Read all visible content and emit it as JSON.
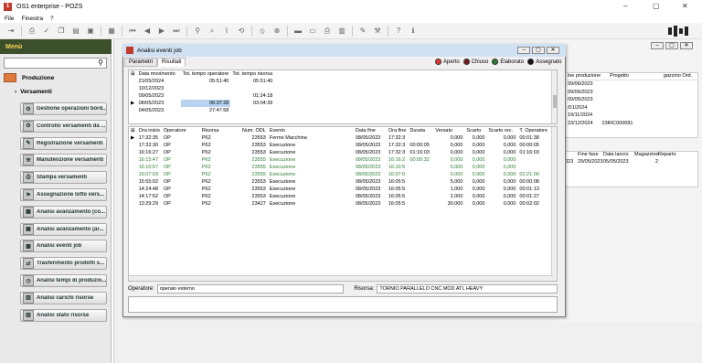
{
  "app": {
    "title": "OS1 enterprise - POZS"
  },
  "menubar": {
    "file": "File",
    "window": "Finestra",
    "help": "?"
  },
  "left": {
    "header": "Menù",
    "section": "Produzione",
    "subsection": "Versamenti",
    "items": [
      "Gestione operazioni bord...",
      "Controllo versamenti da ...",
      "Registrazione versamenti",
      "Manutenzione versamenti",
      "Stampa versamenti",
      "Assegnazione lotto vers...",
      "Analisi avanzamento (co...",
      "Analisi avanzamento (ar...",
      "Analisi eventi job",
      "Trasferimento prodotti s...",
      "Analisi tempi di produzio...",
      "Analisi carichi risorse",
      "Analisi stato risorse"
    ]
  },
  "background": {
    "headers": [
      "ine produzione",
      "Progetto",
      "gazzino Ord."
    ],
    "dates": [
      "09/06/2023",
      "09/06/2023",
      "09/05/2023",
      "/01/2024",
      "19/11/2024",
      "23/12/2024"
    ],
    "project": "23RIC000081",
    "headers2": [
      "",
      "Fine fase",
      "Data lancio",
      "Magazzino",
      "Reparto"
    ],
    "row2": [
      "023",
      "29/05/2023",
      "05/05/2023",
      "2",
      ""
    ]
  },
  "dialog": {
    "title": "Analisi eventi job",
    "tabs": [
      "Parametri",
      "Risultati"
    ],
    "legend": [
      {
        "label": "Aperto",
        "color": "#e53935"
      },
      {
        "label": "Chiuso",
        "color": "#7b1a1a"
      },
      {
        "label": "Elaborato",
        "color": "#2e7d32"
      },
      {
        "label": "Assegnato",
        "color": "#111111"
      }
    ],
    "upper": {
      "headers": [
        "Data movimento",
        "Tot. tempo operatore",
        "Tot. tempo risorsa"
      ],
      "rows": [
        [
          "21/05/2024",
          "05:51:40",
          "05:51:40"
        ],
        [
          "10/12/2023",
          "",
          ""
        ],
        [
          "09/05/2023",
          "",
          "01:24:18"
        ],
        [
          "08/05/2023",
          "06:37:28",
          "03:04:39"
        ],
        [
          "04/05/2023",
          "27:47:58",
          ""
        ]
      ]
    },
    "lower": {
      "headers": [
        "Ora inizio",
        "Operatore",
        "Risorsa",
        "Num. ODL",
        "Evento",
        "Data fine",
        "Ora fine",
        "Durata",
        "Versato",
        "Scarto",
        "Scarto rec.",
        "T. Operatore"
      ],
      "rows": [
        [
          "17:32:35",
          "OP",
          "P62",
          "23553",
          "Fermo Macchina",
          "08/05/2023",
          "17:32:3",
          "",
          "0,000",
          "0,000",
          "0,000",
          "00:01:38"
        ],
        [
          "17:32:30",
          "OP",
          "P62",
          "23553",
          "Esecuzione",
          "08/05/2023",
          "17:32:3",
          "00:00:05",
          "0,000",
          "0,000",
          "0,000",
          "00:00:05"
        ],
        [
          "16:16:27",
          "OP",
          "P62",
          "23553",
          "Esecuzione",
          "08/05/2023",
          "17:32:3",
          "01:16:03",
          "0,000",
          "0,000",
          "0,000",
          "01:16:03"
        ],
        [
          "16:15:47",
          "OP",
          "P62",
          "23555",
          "Esecuzione",
          "08/05/2023",
          "16:16:2",
          "00:00:32",
          "0,000",
          "0,000",
          "0,000",
          ""
        ],
        [
          "16:10:57",
          "OP",
          "P62",
          "23555",
          "Esecuzione",
          "08/05/2023",
          "16:10:5",
          "",
          "0,000",
          "0,000",
          "0,000",
          ""
        ],
        [
          "16:07:03",
          "OP",
          "P62",
          "23555",
          "Esecuzione",
          "08/05/2023",
          "16:07:0",
          "",
          "0,000",
          "0,000",
          "0,000",
          "02:21:00"
        ],
        [
          "15:55:02",
          "OP",
          "P62",
          "23553",
          "Esecuzione",
          "08/05/2023",
          "16:05:5",
          "",
          "5,000",
          "0,000",
          "0,000",
          "00:00:08"
        ],
        [
          "14:24:48",
          "OP",
          "P62",
          "23553",
          "Esecuzione",
          "08/05/2023",
          "16:05:5",
          "",
          "1,000",
          "0,000",
          "0,000",
          "00:01:13"
        ],
        [
          "14:17:52",
          "OP",
          "P62",
          "23553",
          "Esecuzione",
          "08/05/2023",
          "16:05:5",
          "",
          "2,000",
          "0,000",
          "0,000",
          "00:01:27"
        ],
        [
          "13:29:29",
          "OP",
          "P62",
          "23427",
          "Esecuzione",
          "08/05/2023",
          "16:05:5",
          "",
          "30,000",
          "0,000",
          "0,000",
          "00:02:02"
        ]
      ],
      "green_rows": [
        3,
        4,
        5
      ]
    },
    "footer": {
      "operator_label": "Operatore:",
      "operator_value": "operaio esterno",
      "resource_label": "Risorsa:",
      "resource_value": "TORNIO PARALLELO CNC MOD ATL HEAVY"
    }
  }
}
